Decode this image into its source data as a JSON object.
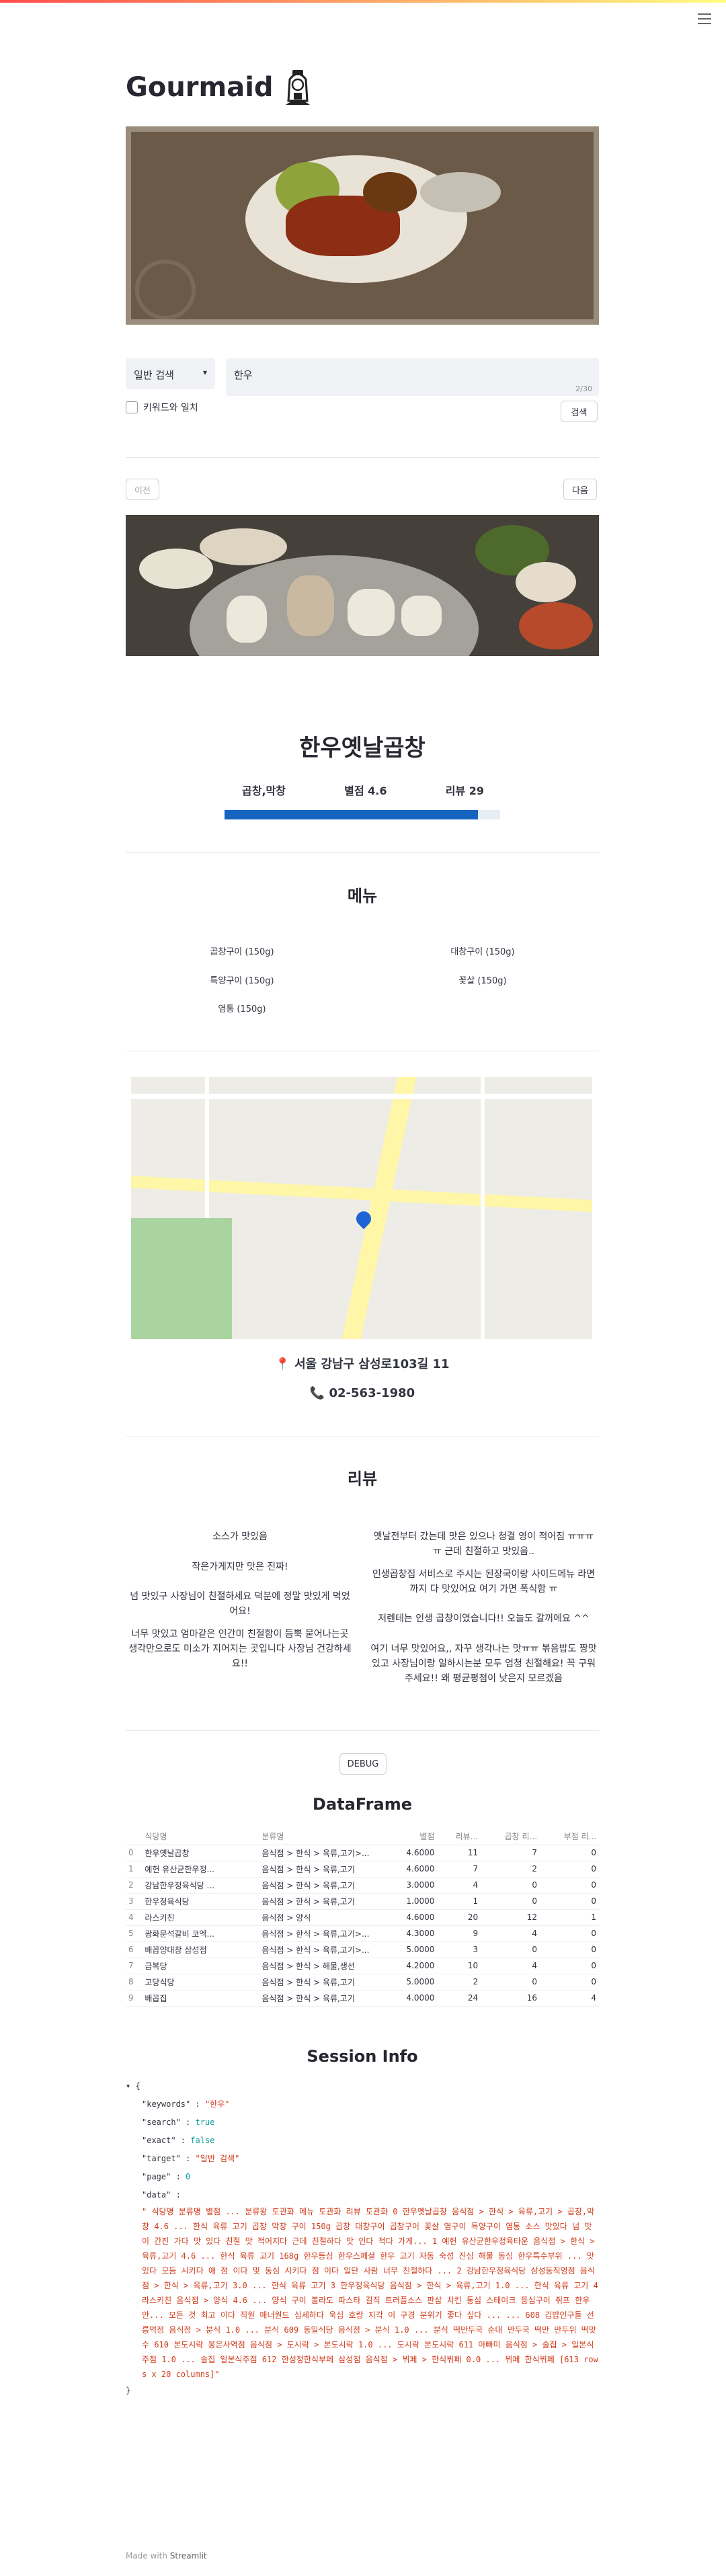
{
  "app": {
    "title": "Gourmaid",
    "footer_prefix": "Made with",
    "footer_brand": "Streamlit"
  },
  "search": {
    "mode_label": "일반 검색",
    "value": "한우",
    "counter": "2/30",
    "exact_label": "키워드와 일치",
    "search_button": "검색"
  },
  "nav": {
    "prev_label": "이전",
    "next_label": "다음"
  },
  "restaurant": {
    "name": "한우옛날곱창",
    "category": "곱창,막창",
    "rating_text": "별점 4.6",
    "review_text": "리뷰 29",
    "rating_fraction": 0.92,
    "address": "📍 서울 강남구 삼성로103길 11",
    "phone": "📞 02-563-1980"
  },
  "menu": {
    "heading": "메뉴",
    "items": [
      "곱창구이 (150g)",
      "대창구이 (150g)",
      "특양구이 (150g)",
      "꽃살 (150g)",
      "염통 (150g)"
    ]
  },
  "reviews": {
    "heading": "리뷰",
    "left": [
      "소스가 맛있음",
      "작은가게지만 맛은 진짜!",
      "넘 맛있구 사장님이 친절하세요 덕분에 정말 맛있게 먹었어요!",
      "너무 맛있고 엄마같은 인간미 친절함이 듬뿍 묻어나는곳 생각만으로도 미소가 지어지는 곳입니다 사장님 건강하세요!!"
    ],
    "right": [
      "옛날전부터 갔는데 맛은 있으나 청결 영이 적어짐 ㅠㅠㅠ ㅠ 근데 친절하고 맛있음..",
      "인생곱창집 서비스로 주시는 된장국이랑 사이드메뉴 라면까지 다 맛있어요 여기 가면 폭식함 ㅠ",
      "저렌테는 인생 곱창이였습니다!! 오늘도 갈꺼에요 ^^",
      "여기 너무 맛있어요,, 자꾸 생각나는 맛ㅠㅠ 볶음밥도 짱맛있고 사장님이랑 일하시는분 모두 엄청 친절해요! 꼭 구워주세요!! 왜 평균평점이 낮은지 모르겠음"
    ]
  },
  "debug": {
    "button": "DEBUG"
  },
  "dataframe": {
    "heading": "DataFrame",
    "columns": [
      "",
      "식당명",
      "분류명",
      "별점",
      "리뷰...",
      "곱창 리...",
      "부점 리..."
    ],
    "rows": [
      [
        "0",
        "한우옛날곱창",
        "음식점 > 한식 > 육류,고기>...",
        "4.6000",
        "11",
        "7",
        "0"
      ],
      [
        "1",
        "예헌 유산균한우정...",
        "음식점 > 한식 > 육류,고기",
        "4.6000",
        "7",
        "2",
        "0"
      ],
      [
        "2",
        "강남한우정육식당 ...",
        "음식점 > 한식 > 육류,고기",
        "3.0000",
        "4",
        "0",
        "0"
      ],
      [
        "3",
        "한우정육식당",
        "음식점 > 한식 > 육류,고기",
        "1.0000",
        "1",
        "0",
        "0"
      ],
      [
        "4",
        "라스키친",
        "음식점 > 양식",
        "4.6000",
        "20",
        "12",
        "1"
      ],
      [
        "5",
        "광화문석갈비 코엑...",
        "음식점 > 한식 > 육류,고기>...",
        "4.3000",
        "9",
        "4",
        "0"
      ],
      [
        "6",
        "배꼽양대창 삼성점",
        "음식점 > 한식 > 육류,고기>...",
        "5.0000",
        "3",
        "0",
        "0"
      ],
      [
        "7",
        "금복당",
        "음식점 > 한식 > 해물,생선",
        "4.2000",
        "10",
        "4",
        "0"
      ],
      [
        "8",
        "고당식당",
        "음식점 > 한식 > 육류,고기",
        "5.0000",
        "2",
        "0",
        "0"
      ],
      [
        "9",
        "배꼽집",
        "음식점 > 한식 > 육류,고기",
        "4.0000",
        "24",
        "16",
        "4"
      ]
    ]
  },
  "session": {
    "heading": "Session Info",
    "keywords_key": "\"keywords\"",
    "keywords_val": "\"한우\"",
    "search_key": "\"search\"",
    "search_val": "true",
    "exact_key": "\"exact\"",
    "exact_val": "false",
    "target_key": "\"target\"",
    "target_val": "\"일반 검색\"",
    "page_key": "\"page\"",
    "page_val": "0",
    "data_key": "\"data\"",
    "data_val": "\" 식당명 분류명 별점 ... 분류왕 토관화 메뉴 토관화 리뷰 토관화 0 한우옛날곱창 음식점 > 한식 > 육류,고기 > 곱창,막창 4.6 ... 한식 육류 고기 곱창 막창 구이 150g 곱창 대창구이 곱창구이 꽃살 염구이 특양구이 염통 소스 맛있다 넘 맛이 간진 가다 맛 있다 친절 맛 적어지다 근데 친절하다 맛 인다 적다 가게... 1 예헌 유산균한우정육타운 음식점 > 한식 > 육류,고기 4.6 ... 한식 육류 고기 168g 한우등심 한우스페셜 한우 고기 자동 숙성 진심 해물 동심 한우특수부위 ... 맛있다 모듬 시키다 애 점 이다 및 동심 시키다 점 이다 일단 사람 너무 친절하다 ... 2 강남한우정육식당 삼성동직영점 음식점 > 한식 > 육류,고기 3.0 ... 한식 육류 고기 3 한우정육식당 음식점 > 한식 > 육류,고기 1.0 ... 한식 육류 고기 4 라스키친 음식점 > 양식 4.6 ... 양식 구이 볼라도 파스타 길직 트러플소스 판삼 치킨 통심 스테이크 등심구이 쥐프 한우 안... 모든 것 최고 이다 직원 매너원드 심세하다 욱심 호랑 지각 이 구경 분위기 좋다 싶다 ... ... 608 김밥인구들 선릉역점 음식점 > 분식 1.0 ... 분식 609 동일식당 음식점 > 분식 1.0 ... 분식 떡만두국 순대 만두국 떡만 만두위 떡맞수 610 본도시락 봉은사역점 음식점 > 도시락 > 본도시락 1.0 ... 도시락 본도시락 611 아빠미 음식점 > 술집 > 일본식주점 1.0 ... 술집 일본식주점 612 한성정한식부페 삼성점 음식점 > 뷔페 > 한식뷔페 0.0 ... 뷔페 한식뷔페 [613 rows x 20 columns]\""
  }
}
